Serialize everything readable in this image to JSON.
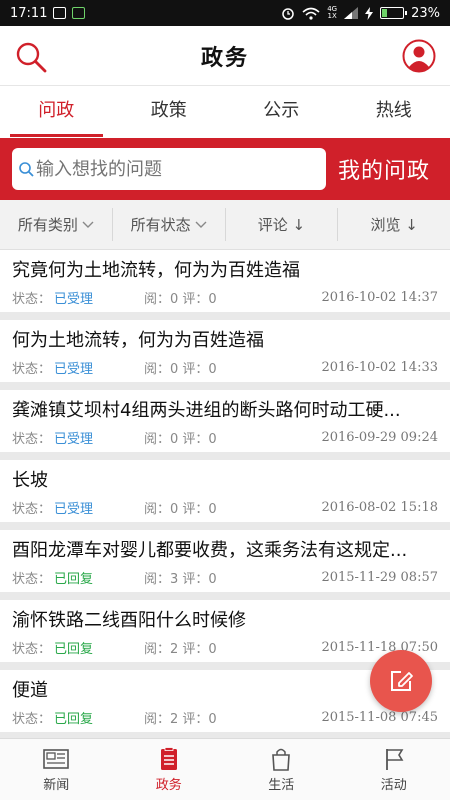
{
  "statusbar": {
    "time": "17:11",
    "battery": "23%",
    "network_top": "4G",
    "network_bottom": "1X"
  },
  "header": {
    "title": "政务"
  },
  "tabs": [
    {
      "label": "问政",
      "active": true
    },
    {
      "label": "政策",
      "active": false
    },
    {
      "label": "公示",
      "active": false
    },
    {
      "label": "热线",
      "active": false
    }
  ],
  "search": {
    "placeholder": "输入想找的问题",
    "my_button": "我的问政"
  },
  "filters": [
    {
      "label": "所有类别",
      "icon": "chevron-down-icon"
    },
    {
      "label": "所有状态",
      "icon": "chevron-down-icon"
    },
    {
      "label": "评论 ↓"
    },
    {
      "label": "浏览 ↓"
    }
  ],
  "list": {
    "status_label": "状态：",
    "items": [
      {
        "title": "究竟何为土地流转，何为为百姓造福",
        "status": "已受理",
        "counts": "阅：0  评：0",
        "date": "2016-10-02 14:37"
      },
      {
        "title": "何为土地流转，何为为百姓造福",
        "status": "已受理",
        "counts": "阅：0  评：0",
        "date": "2016-10-02 14:33"
      },
      {
        "title": "龚滩镇艾坝村4组两头进组的断头路何时动工硬...",
        "status": "已受理",
        "counts": "阅：0  评：0",
        "date": "2016-09-29 09:24"
      },
      {
        "title": "长坡",
        "status": "已受理",
        "counts": "阅：0  评：0",
        "date": "2016-08-02 15:18"
      },
      {
        "title": "酉阳龙潭车对婴儿都要收费，这乘务法有这规定...",
        "status": "已回复",
        "counts": "阅：3  评：0",
        "date": "2015-11-29 08:57"
      },
      {
        "title": "渝怀铁路二线酉阳什么时候修",
        "status": "已回复",
        "counts": "阅：2  评：0",
        "date": "2015-11-18 07:50"
      },
      {
        "title": "便道",
        "status": "已回复",
        "counts": "阅：2  评：0",
        "date": "2015-11-08 07:45"
      }
    ]
  },
  "bottom_nav": [
    {
      "label": "新闻",
      "icon": "newspaper-icon",
      "active": false
    },
    {
      "label": "政务",
      "icon": "clipboard-icon",
      "active": true
    },
    {
      "label": "生活",
      "icon": "shopping-bag-icon",
      "active": false
    },
    {
      "label": "活动",
      "icon": "flag-icon",
      "active": false
    }
  ],
  "colors": {
    "brand_red": "#d0202a",
    "accepted_blue": "#3a8fd6",
    "replied_green": "#2aa84a",
    "fab": "#e8554d"
  }
}
